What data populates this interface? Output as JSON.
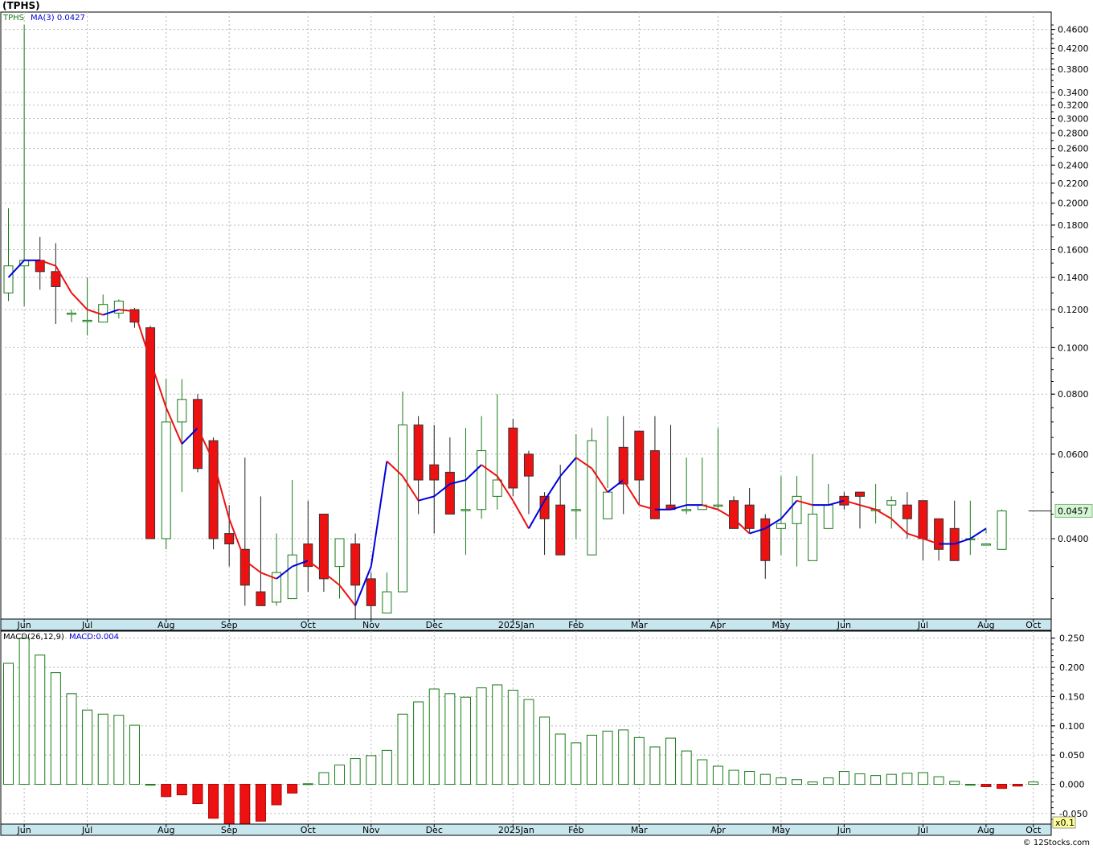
{
  "title": "(TPHS)",
  "footer": "© 12Stocks.com",
  "colors": {
    "up": "#1a7a1a",
    "down": "#ee1111",
    "ma_up": "#0000dd",
    "ma_down": "#ee1111",
    "axis_band": "#c8e6ee",
    "last_price_bg": "#d6f5d6",
    "scale_bg": "#ffff99"
  },
  "price_panel": {
    "legend_symbol": "TPHS",
    "legend_ma": "MA(3)",
    "legend_ma_value": "0.0427",
    "last_price": "0.0457",
    "y_ticks": [
      "0.4600",
      "0.4200",
      "0.3800",
      "0.3400",
      "0.3200",
      "0.3000",
      "0.2800",
      "0.2600",
      "0.2400",
      "0.2200",
      "0.2000",
      "0.1800",
      "0.1600",
      "0.1400",
      "0.1200",
      "0.1000",
      "0.0800",
      "0.0600",
      "0.0400"
    ],
    "y_scale": "log",
    "y_range": [
      0.0272,
      0.5
    ]
  },
  "macd_panel": {
    "legend_macd": "MACD(26,12,9)",
    "legend_value": "MACD:0.004",
    "y_ticks": [
      "0.250",
      "0.200",
      "0.150",
      "0.100",
      "0.050",
      "0.000",
      "-0.050"
    ],
    "y_range": [
      -0.068,
      0.262
    ],
    "scale_label": "x0.1"
  },
  "x_axis": {
    "months": [
      "Jun",
      "Jul",
      "Aug",
      "Sep",
      "Oct",
      "Nov",
      "Dec",
      "2025Jan",
      "Feb",
      "Mar",
      "Apr",
      "May",
      "Jun",
      "Jul",
      "Aug",
      "Oct"
    ]
  },
  "chart_data": [
    {
      "type": "candlestick",
      "title": "(TPHS)",
      "y_scale": "log",
      "x": [
        "2024-05-31",
        "2024-06-07",
        "2024-06-14",
        "2024-06-21",
        "2024-06-28",
        "2024-07-05",
        "2024-07-12",
        "2024-07-19",
        "2024-07-26",
        "2024-08-02",
        "2024-08-09",
        "2024-08-16",
        "2024-08-23",
        "2024-08-30",
        "2024-09-06",
        "2024-09-13",
        "2024-09-20",
        "2024-09-27",
        "2024-10-04",
        "2024-10-11",
        "2024-10-18",
        "2024-10-25",
        "2024-11-01",
        "2024-11-08",
        "2024-11-15",
        "2024-11-22",
        "2024-11-29",
        "2024-12-06",
        "2024-12-13",
        "2024-12-20",
        "2024-12-27",
        "2025-01-03",
        "2025-01-10",
        "2025-01-17",
        "2025-01-24",
        "2025-01-31",
        "2025-02-07",
        "2025-02-14",
        "2025-02-21",
        "2025-02-28",
        "2025-03-07",
        "2025-03-14",
        "2025-03-21",
        "2025-03-28",
        "2025-04-04",
        "2025-04-11",
        "2025-04-18",
        "2025-04-25",
        "2025-05-02",
        "2025-05-09",
        "2025-05-16",
        "2025-05-23",
        "2025-05-30",
        "2025-06-06",
        "2025-06-13",
        "2025-06-20",
        "2025-06-27",
        "2025-07-04",
        "2025-07-11",
        "2025-07-18",
        "2025-07-25",
        "2025-08-01",
        "2025-08-08",
        "2025-08-15",
        "2025-08-22",
        "2025-08-29"
      ],
      "series": [
        {
          "name": "TPHS",
          "open": [
            0.13,
            0.148,
            0.152,
            0.144,
            0.118,
            0.114,
            0.113,
            0.118,
            0.12,
            0.11,
            0.04,
            0.07,
            0.078,
            0.064,
            0.041,
            0.038,
            0.031,
            0.0295,
            0.03,
            0.039,
            0.045,
            0.035,
            0.039,
            0.033,
            0.028,
            0.031,
            0.069,
            0.057,
            0.055,
            0.046,
            0.046,
            0.049,
            0.068,
            0.06,
            0.049,
            0.047,
            0.046,
            0.037,
            0.044,
            0.062,
            0.067,
            0.061,
            0.047,
            0.046,
            0.046,
            0.047,
            0.048,
            0.047,
            0.044,
            0.042,
            0.043,
            0.036,
            0.042,
            0.049,
            0.05,
            0.046,
            0.047,
            0.047,
            0.048,
            0.044,
            0.042,
            0.04,
            0.039,
            0.038,
            0.039,
            0.0457
          ],
          "high": [
            0.195,
            0.47,
            0.17,
            0.165,
            0.12,
            0.14,
            0.129,
            0.126,
            0.121,
            0.111,
            0.086,
            0.086,
            0.08,
            0.065,
            0.047,
            0.059,
            0.049,
            0.041,
            0.053,
            0.048,
            0.043,
            0.04,
            0.041,
            0.034,
            0.031,
            0.081,
            0.072,
            0.069,
            0.065,
            0.068,
            0.072,
            0.08,
            0.071,
            0.061,
            0.05,
            0.057,
            0.066,
            0.068,
            0.072,
            0.072,
            0.065,
            0.072,
            0.069,
            0.059,
            0.059,
            0.068,
            0.049,
            0.051,
            0.045,
            0.054,
            0.054,
            0.06,
            0.052,
            0.05,
            0.05,
            0.052,
            0.049,
            0.05,
            0.048,
            0.043,
            0.048,
            0.048,
            0.042,
            0.046,
            0.0457
          ],
          "low": [
            0.125,
            0.122,
            0.132,
            0.112,
            0.113,
            0.106,
            0.113,
            0.115,
            0.11,
            0.04,
            0.038,
            0.05,
            0.055,
            0.038,
            0.035,
            0.029,
            0.029,
            0.029,
            0.031,
            0.031,
            0.031,
            0.03,
            0.027,
            0.027,
            0.034,
            0.045,
            0.045,
            0.041,
            0.045,
            0.037,
            0.044,
            0.046,
            0.049,
            0.045,
            0.037,
            0.038,
            0.04,
            0.043,
            0.051,
            0.045,
            0.047,
            0.051,
            0.046,
            0.045,
            0.046,
            0.046,
            0.044,
            0.041,
            0.033,
            0.037,
            0.035,
            0.041,
            0.042,
            0.046,
            0.042,
            0.043,
            0.042,
            0.04,
            0.036,
            0.036,
            0.038,
            0.037,
            0.041,
            0.0457
          ],
          "close": [
            0.148,
            0.152,
            0.144,
            0.134,
            0.118,
            0.114,
            0.123,
            0.125,
            0.113,
            0.04,
            0.07,
            0.078,
            0.056,
            0.04,
            0.039,
            0.032,
            0.029,
            0.034,
            0.037,
            0.035,
            0.033,
            0.04,
            0.032,
            0.029,
            0.031,
            0.069,
            0.053,
            0.053,
            0.045,
            0.046,
            0.061,
            0.053,
            0.051,
            0.054,
            0.044,
            0.037,
            0.046,
            0.064,
            0.05,
            0.052,
            0.053,
            0.044,
            0.046,
            0.046,
            0.047,
            0.047,
            0.042,
            0.042,
            0.036,
            0.043,
            0.049,
            0.045,
            0.047,
            0.047,
            0.049,
            0.046,
            0.048,
            0.044,
            0.04,
            0.038,
            0.036,
            0.04,
            0.039,
            0.0457
          ]
        },
        {
          "name": "MA(3)",
          "values": [
            0.14,
            0.152,
            0.152,
            0.148,
            0.13,
            0.12,
            0.117,
            0.12,
            0.119,
            0.094,
            0.075,
            0.063,
            0.068,
            0.058,
            0.044,
            0.036,
            0.034,
            0.033,
            0.035,
            0.036,
            0.034,
            0.032,
            0.029,
            0.035,
            0.058,
            0.054,
            0.048,
            0.049,
            0.052,
            0.053,
            0.057,
            0.054,
            0.048,
            0.042,
            0.048,
            0.054,
            0.059,
            0.056,
            0.05,
            0.053,
            0.047,
            0.046,
            0.046,
            0.047,
            0.047,
            0.046,
            0.044,
            0.041,
            0.042,
            0.044,
            0.048,
            0.047,
            0.047,
            0.048,
            0.047,
            0.046,
            0.044,
            0.041,
            0.04,
            0.039,
            0.039,
            0.04,
            0.042
          ]
        }
      ]
    },
    {
      "type": "bar",
      "title": "MACD(26,12,9)",
      "x": [
        "2024-05-31",
        "2024-06-07",
        "2024-06-14",
        "2024-06-21",
        "2024-06-28",
        "2024-07-05",
        "2024-07-12",
        "2024-07-19",
        "2024-07-26",
        "2024-08-02",
        "2024-08-09",
        "2024-08-16",
        "2024-08-23",
        "2024-08-30",
        "2024-09-06",
        "2024-09-13",
        "2024-09-20",
        "2024-09-27",
        "2024-10-04",
        "2024-10-11",
        "2024-10-18",
        "2024-10-25",
        "2024-11-01",
        "2024-11-08",
        "2024-11-15",
        "2024-11-22",
        "2024-11-29",
        "2024-12-06",
        "2024-12-13",
        "2024-12-20",
        "2024-12-27",
        "2025-01-03",
        "2025-01-10",
        "2025-01-17",
        "2025-01-24",
        "2025-01-31",
        "2025-02-07",
        "2025-02-14",
        "2025-02-21",
        "2025-02-28",
        "2025-03-07",
        "2025-03-14",
        "2025-03-21",
        "2025-03-28",
        "2025-04-04",
        "2025-04-11",
        "2025-04-18",
        "2025-04-25",
        "2025-05-02",
        "2025-05-09",
        "2025-05-16",
        "2025-05-23",
        "2025-05-30",
        "2025-06-06",
        "2025-06-13",
        "2025-06-20",
        "2025-06-27",
        "2025-07-04",
        "2025-07-11",
        "2025-07-18",
        "2025-07-25",
        "2025-08-01",
        "2025-08-08",
        "2025-08-15",
        "2025-08-22",
        "2025-08-29"
      ],
      "series": [
        {
          "name": "MACD",
          "values": [
            0.207,
            0.25,
            0.221,
            0.191,
            0.155,
            0.127,
            0.12,
            0.118,
            0.101,
            0.0,
            -0.021,
            -0.018,
            -0.033,
            -0.058,
            -0.07,
            -0.068,
            -0.063,
            -0.035,
            -0.015,
            0.001,
            0.02,
            0.033,
            0.044,
            0.049,
            0.058,
            0.12,
            0.141,
            0.163,
            0.155,
            0.149,
            0.165,
            0.17,
            0.161,
            0.145,
            0.115,
            0.086,
            0.071,
            0.084,
            0.091,
            0.093,
            0.08,
            0.064,
            0.079,
            0.057,
            0.042,
            0.031,
            0.024,
            0.022,
            0.017,
            0.011,
            0.008,
            0.004,
            0.011,
            0.022,
            0.018,
            0.015,
            0.017,
            0.019,
            0.02,
            0.013,
            0.005,
            0.0,
            -0.004,
            -0.007,
            -0.003,
            0.004
          ]
        }
      ],
      "ylim": [
        -0.068,
        0.262
      ]
    }
  ]
}
